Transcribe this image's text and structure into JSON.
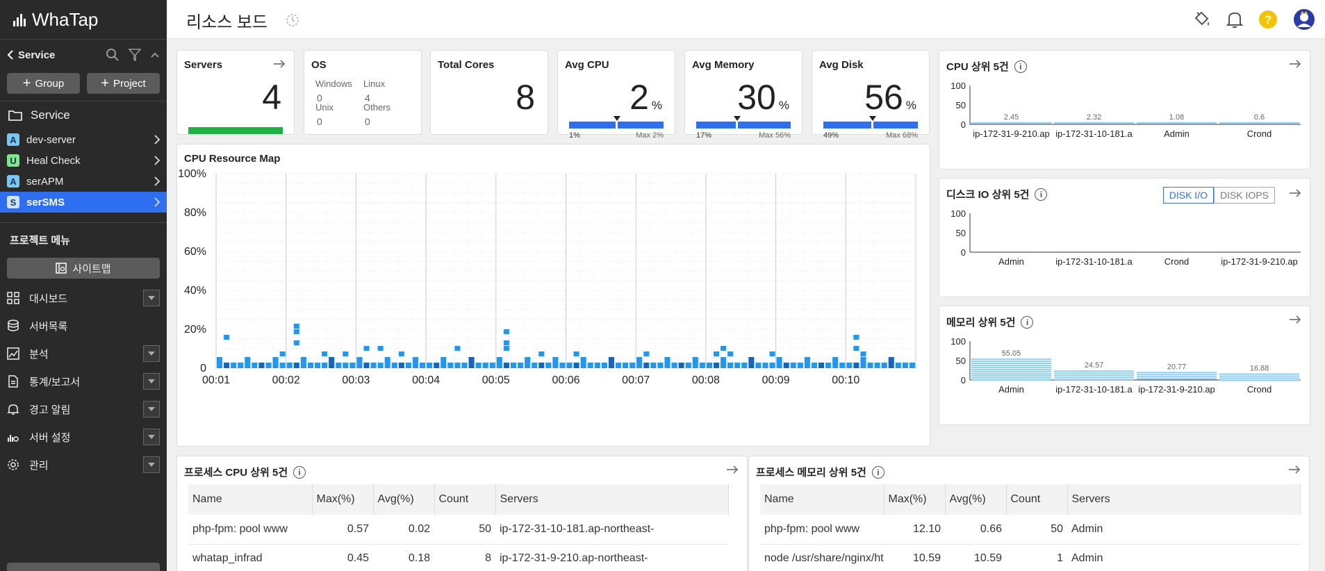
{
  "app": {
    "name": "WhaTap"
  },
  "sidebar": {
    "service_label": "Service",
    "group_btn": "Group",
    "project_btn": "Project",
    "folder_label": "Service",
    "projects": [
      {
        "badge": "A",
        "name": "dev-server",
        "color": "#7cc7f0"
      },
      {
        "badge": "U",
        "name": "Heal Check",
        "color": "#7fe58a"
      },
      {
        "badge": "A",
        "name": "serAPM",
        "color": "#7cc7f0"
      },
      {
        "badge": "S",
        "name": "serSMS",
        "color": "#cfe4ff",
        "active": true
      }
    ],
    "menu_title": "프로젝트 메뉴",
    "sitemap_label": "사이트맵",
    "menu": [
      {
        "label": "대시보드",
        "icon": "grid-icon",
        "dropdown": true
      },
      {
        "label": "서버목록",
        "icon": "database-icon",
        "dropdown": false
      },
      {
        "label": "분석",
        "icon": "image-chart-icon",
        "dropdown": true
      },
      {
        "label": "통계/보고서",
        "icon": "document-icon",
        "dropdown": true
      },
      {
        "label": "경고 알림",
        "icon": "bell-icon",
        "dropdown": true
      },
      {
        "label": "서버 설정",
        "icon": "server-settings-icon",
        "dropdown": true
      },
      {
        "label": "관리",
        "icon": "gear-icon",
        "dropdown": true
      }
    ]
  },
  "header": {
    "title": "리소스 보드",
    "icons": [
      "paint-bucket-icon",
      "bell-icon",
      "help-icon",
      "avatar"
    ]
  },
  "kpis": {
    "servers": {
      "label": "Servers",
      "value": "4",
      "bar_fraction": 1.0,
      "bar_color": "#1fb141"
    },
    "os": {
      "label": "OS",
      "windows_label": "Windows",
      "windows_value": "0",
      "linux_label": "Linux",
      "linux_value": "4",
      "unix_label": "Unix",
      "unix_value": "0",
      "others_label": "Others",
      "others_value": "0"
    },
    "cores": {
      "label": "Total Cores",
      "value": "8"
    },
    "avg_cpu": {
      "label": "Avg CPU",
      "value": "2",
      "unit": "%",
      "min_label": "1%",
      "max_label": "Max 2%"
    },
    "avg_memory": {
      "label": "Avg Memory",
      "value": "30",
      "unit": "%",
      "min_label": "17%",
      "max_label": "Max 56%"
    },
    "avg_disk": {
      "label": "Avg Disk",
      "value": "56",
      "unit": "%",
      "min_label": "49%",
      "max_label": "Max 68%"
    }
  },
  "resource_map": {
    "title": "CPU Resource Map",
    "y_labels": [
      "100%",
      "80%",
      "60%",
      "40%",
      "20%",
      "0"
    ],
    "x_labels": [
      "00:01",
      "00:02",
      "00:03",
      "00:04",
      "00:05",
      "00:06",
      "00:07",
      "00:08",
      "00:09",
      "00:10"
    ]
  },
  "cpu_top5": {
    "title": "CPU 상위 5건",
    "y_labels": [
      "100",
      "50",
      "0"
    ],
    "bars": [
      {
        "name": "ip-172-31-9-210.ap",
        "value": 2.45,
        "label": "2.45"
      },
      {
        "name": "ip-172-31-10-181.a",
        "value": 2.32,
        "label": "2.32"
      },
      {
        "name": "Admin",
        "value": 1.08,
        "label": "1.08"
      },
      {
        "name": "Crond",
        "value": 0.6,
        "label": "0.6"
      }
    ]
  },
  "disk_top5": {
    "title": "디스크 IO 상위 5건",
    "toggle": [
      "DISK I/O",
      "DISK IOPS"
    ],
    "y_labels": [
      "100",
      "50",
      "0"
    ],
    "bars": [
      {
        "name": "Admin"
      },
      {
        "name": "ip-172-31-10-181.a"
      },
      {
        "name": "Crond"
      },
      {
        "name": "ip-172-31-9-210.ap"
      }
    ]
  },
  "mem_top5": {
    "title": "메모리 상위 5건",
    "y_labels": [
      "100",
      "50",
      "0"
    ],
    "bars": [
      {
        "name": "Admin",
        "value": 55.05,
        "label": "55.05"
      },
      {
        "name": "ip-172-31-10-181.a",
        "value": 24.57,
        "label": "24.57"
      },
      {
        "name": "ip-172-31-9-210.ap",
        "value": 20.77,
        "label": "20.77"
      },
      {
        "name": "Crond",
        "value": 16.88,
        "label": "16.88"
      }
    ]
  },
  "proc_cpu": {
    "title": "프로세스 CPU 상위 5건",
    "columns": [
      "Name",
      "Max(%)",
      "Avg(%)",
      "Count",
      "Servers"
    ],
    "rows": [
      [
        "php-fpm: pool www",
        "0.57",
        "0.02",
        "50",
        "ip-172-31-10-181.ap-northeast-"
      ],
      [
        "whatap_infrad",
        "0.45",
        "0.18",
        "8",
        "ip-172-31-9-210.ap-northeast-"
      ]
    ]
  },
  "proc_mem": {
    "title": "프로세스 메모리 상위 5건",
    "columns": [
      "Name",
      "Max(%)",
      "Avg(%)",
      "Count",
      "Servers"
    ],
    "rows": [
      [
        "php-fpm: pool www",
        "12.10",
        "0.66",
        "50",
        "Admin"
      ],
      [
        "node /usr/share/nginx/ht…",
        "10.59",
        "10.59",
        "1",
        "Admin"
      ]
    ]
  },
  "colors": {
    "accent": "#2e6ff2",
    "cell_light": "#2196f3",
    "cell_dark": "#1565c0",
    "bar_light": "#8ecdf5"
  }
}
